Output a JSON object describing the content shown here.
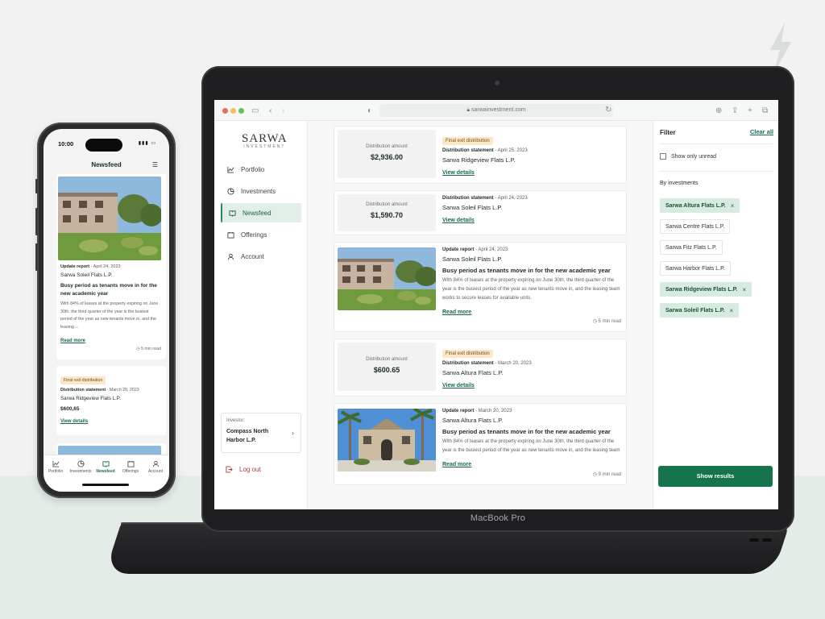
{
  "browser": {
    "url": "sarwainvestment.com"
  },
  "laptop": {
    "model_label": "MacBook Pro"
  },
  "sidebar": {
    "brand": "SARWA",
    "brand_sub": "INVESTMENT",
    "items": [
      {
        "label": "Portfolio",
        "icon": "chart-line-icon"
      },
      {
        "label": "Investments",
        "icon": "pie-chart-icon"
      },
      {
        "label": "Newsfeed",
        "icon": "book-icon",
        "active": true
      },
      {
        "label": "Offerings",
        "icon": "offerings-icon"
      },
      {
        "label": "Account",
        "icon": "user-icon"
      }
    ],
    "investor_label": "Investor:",
    "investor_name": "Compass North Harbor L.P.",
    "logout_label": "Log out"
  },
  "feed": {
    "cards": [
      {
        "kind": "distribution",
        "badge": "Final exit distribution",
        "amount_label": "Distribution amount",
        "amount": "$2,936.00",
        "meta_type": "Distribution statement",
        "meta_date": " - April 25, 2023",
        "property": "Sarwa Ridgeview Flats L.P.",
        "link": "View details"
      },
      {
        "kind": "distribution",
        "badge": "",
        "amount_label": "Distribution amount",
        "amount": "$1,590.70",
        "meta_type": "Distribution statement",
        "meta_date": " - April 24, 2023",
        "property": "Sarwa Soleil Flats L.P.",
        "link": "View details"
      },
      {
        "kind": "update",
        "meta_type": "Update report",
        "meta_date": " - April 24, 2023",
        "property": "Sarwa Soleil Flats L.P.",
        "headline": "Busy period as tenants move in for the new academic year",
        "excerpt": "With 84% of leases at the property expiring on June 30th, the third quarter of the year is the busiest period of the year as new tenants move in, and the leasing team works to secure leases for available units.",
        "link": "Read more",
        "read_time": "5 min read"
      },
      {
        "kind": "distribution",
        "badge": "Final exit distribution",
        "amount_label": "Distribution amount",
        "amount": "$600.65",
        "meta_type": "Distribution statement",
        "meta_date": " - March 20, 2023",
        "property": "Sarwa Altura Flats L.P.",
        "link": "View details"
      },
      {
        "kind": "update",
        "meta_type": "Update report",
        "meta_date": " - March 20, 2023",
        "property": "Sarwa Altura Flats L.P.",
        "headline": "Busy period as tenants move in for the new academic year",
        "excerpt": "With 84% of leases at the property expiring on June 30th, the third quarter of the year is the busiest period of the year as new tenants move in, and the leasing team works to secure leases for available units.",
        "link": "Read more",
        "read_time": "9 min read"
      }
    ]
  },
  "filter": {
    "title": "Filter",
    "clear_all": "Clear all",
    "unread_label": "Show only unread",
    "by_investments": "By investments",
    "chips": [
      {
        "label": "Sarwa Altura Flats L.P.",
        "selected": true
      },
      {
        "label": "Sarwa Centre Flats L.P.",
        "selected": false
      },
      {
        "label": "Sarwa Fitz Flats L.P.",
        "selected": false
      },
      {
        "label": "Sarwa Harbor Flats L.P.",
        "selected": false
      },
      {
        "label": "Sarwa Ridgeview Flats L.P.",
        "selected": true
      },
      {
        "label": "Sarwa Soleil Flats L.P.",
        "selected": true
      }
    ],
    "show_results": "Show results",
    "chip_close": "×"
  },
  "phone": {
    "time": "10:00",
    "title": "Newsfeed",
    "card1": {
      "meta_type": "Update report",
      "meta_date": " - April 24, 2023",
      "property": "Sarwa Soleil Flats L.P.",
      "headline": "Busy period as tenants move in for the new academic year",
      "excerpt": "With 84% of leases at the property expiring on June 30th, the third quarter of the year is the busiest period of the year as new tenants move in, and the leasing ...",
      "link": "Read more",
      "read_time": "5 min read"
    },
    "card2": {
      "badge": "Final exit distribution",
      "meta_type": "Distribution statement",
      "meta_date": " - March 20, 2023",
      "property": "Sarwa Ridgeview Flats L.P.",
      "amount": "$600,65",
      "link": "View details"
    },
    "tabs": [
      {
        "label": "Portfolio"
      },
      {
        "label": "Investments"
      },
      {
        "label": "Newsfeed",
        "active": true
      },
      {
        "label": "Offerings"
      },
      {
        "label": "Account"
      }
    ]
  },
  "colors": {
    "accent": "#16744c",
    "chip_selected": "#d7ebe0",
    "badge": "#fbe8c8",
    "logout": "#b23b3b"
  }
}
